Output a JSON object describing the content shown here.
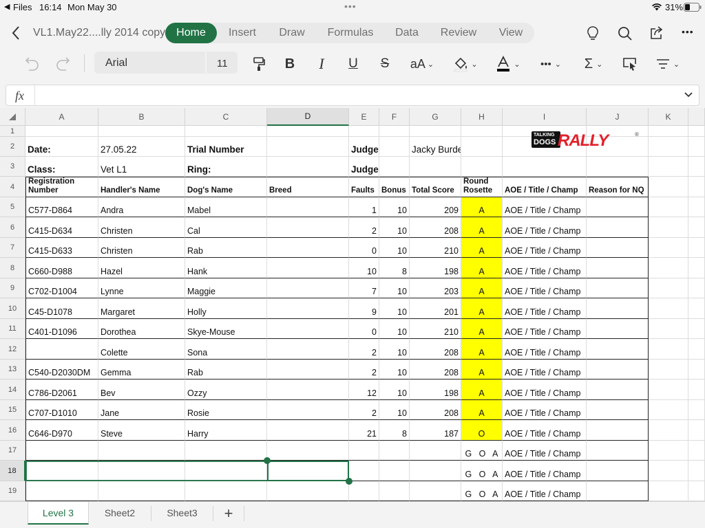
{
  "status": {
    "back_app": "Files",
    "time": "16:14",
    "date": "Mon May 30",
    "battery": "31%"
  },
  "nav": {
    "file_title": "VL1.May22....lly 2014 copy"
  },
  "ribbon_tabs": [
    {
      "label": "Home",
      "active": true
    },
    {
      "label": "Insert"
    },
    {
      "label": "Draw"
    },
    {
      "label": "Formulas"
    },
    {
      "label": "Data"
    },
    {
      "label": "Review"
    },
    {
      "label": "View"
    }
  ],
  "toolbar": {
    "font_name": "Arial",
    "font_size": "11",
    "text_color": "#000000"
  },
  "formula_bar": {
    "fx_label": "fx",
    "value": ""
  },
  "columns": [
    "A",
    "B",
    "C",
    "D",
    "E",
    "F",
    "G",
    "H",
    "I",
    "J",
    "K"
  ],
  "rows": [
    "1",
    "2",
    "3",
    "4",
    "5",
    "6",
    "7",
    "8",
    "9",
    "10",
    "11",
    "12",
    "13",
    "14",
    "15",
    "16",
    "17",
    "18",
    "19"
  ],
  "selected_cell": "D18",
  "logo": {
    "talking": "TALKING",
    "dogs": "DOGS",
    "rally": "RALLY",
    "reg": "®"
  },
  "sheet": {
    "r2": {
      "a": "Date:",
      "b": "27.05.22",
      "c": "Trial Number",
      "e": "Judge:",
      "g": "Jacky Burden"
    },
    "r3": {
      "a": "Class:",
      "b": "Vet L1",
      "c": "Ring:",
      "e": "Judge's Signature:"
    },
    "headers": {
      "reg": "Registration Number",
      "handler": "Handler's Name",
      "dog": "Dog's Name",
      "breed": "Breed",
      "faults": "Faults",
      "bonus": "Bonus",
      "total": "Total Score",
      "rosette": "Round Rosette",
      "aoe": "AOE / Title / Champ",
      "nq": "Reason for NQ"
    },
    "entries": [
      {
        "reg": "C577-D864",
        "handler": "Andra",
        "dog": "Mabel",
        "breed": "",
        "faults": "1",
        "bonus": "10",
        "total": "209",
        "rosette": "A",
        "aoe": "AOE / Title / Champ"
      },
      {
        "reg": "C415-D634",
        "handler": "Christen",
        "dog": "Cal",
        "breed": "",
        "faults": "2",
        "bonus": "10",
        "total": "208",
        "rosette": "A",
        "aoe": "AOE / Title / Champ"
      },
      {
        "reg": "C415-D633",
        "handler": "Christen",
        "dog": "Rab",
        "breed": "",
        "faults": "0",
        "bonus": "10",
        "total": "210",
        "rosette": "A",
        "aoe": "AOE / Title / Champ"
      },
      {
        "reg": "C660-D988",
        "handler": "Hazel",
        "dog": "Hank",
        "breed": "",
        "faults": "10",
        "bonus": "8",
        "total": "198",
        "rosette": "A",
        "aoe": "AOE / Title / Champ"
      },
      {
        "reg": "C702-D1004",
        "handler": "Lynne",
        "dog": "Maggie",
        "breed": "",
        "faults": "7",
        "bonus": "10",
        "total": "203",
        "rosette": "A",
        "aoe": "AOE / Title / Champ"
      },
      {
        "reg": "C45-D1078",
        "handler": "Margaret",
        "dog": "Holly",
        "breed": "",
        "faults": "9",
        "bonus": "10",
        "total": "201",
        "rosette": "A",
        "aoe": "AOE / Title / Champ"
      },
      {
        "reg": "C401-D1096",
        "handler": "Dorothea",
        "dog": "Skye-Mouse",
        "breed": "",
        "faults": "0",
        "bonus": "10",
        "total": "210",
        "rosette": "A",
        "aoe": "AOE / Title / Champ"
      },
      {
        "reg": "",
        "handler": "Colette",
        "dog": "Sona",
        "breed": "",
        "faults": "2",
        "bonus": "10",
        "total": "208",
        "rosette": "A",
        "aoe": "AOE / Title / Champ"
      },
      {
        "reg": "C540-D2030DM",
        "handler": "Gemma",
        "dog": "Rab",
        "breed": "",
        "faults": "2",
        "bonus": "10",
        "total": "208",
        "rosette": "A",
        "aoe": "AOE / Title / Champ"
      },
      {
        "reg": "C786-D2061",
        "handler": "Bev",
        "dog": "Ozzy",
        "breed": "",
        "faults": "12",
        "bonus": "10",
        "total": "198",
        "rosette": "A",
        "aoe": "AOE / Title / Champ"
      },
      {
        "reg": "C707-D1010",
        "handler": "Jane",
        "dog": "Rosie",
        "breed": "",
        "faults": "2",
        "bonus": "10",
        "total": "208",
        "rosette": "A",
        "aoe": "AOE / Title / Champ"
      },
      {
        "reg": "C646-D970",
        "handler": "Steve",
        "dog": "Harry",
        "breed": "",
        "faults": "21",
        "bonus": "8",
        "total": "187",
        "rosette": "O",
        "aoe": "AOE / Title / Champ"
      },
      {
        "reg": "",
        "handler": "",
        "dog": "",
        "breed": "",
        "faults": "",
        "bonus": "",
        "total": "",
        "rosette": "G   O   A",
        "aoe": "AOE / Title / Champ"
      },
      {
        "reg": "",
        "handler": "",
        "dog": "",
        "breed": "",
        "faults": "",
        "bonus": "",
        "total": "",
        "rosette": "G   O   A",
        "aoe": "AOE / Title / Champ"
      },
      {
        "reg": "",
        "handler": "",
        "dog": "",
        "breed": "",
        "faults": "",
        "bonus": "",
        "total": "",
        "rosette": "G   O   A",
        "aoe": "AOE / Title / Champ"
      }
    ]
  },
  "sheet_tabs": [
    {
      "label": "Level 3",
      "active": true
    },
    {
      "label": "Sheet2"
    },
    {
      "label": "Sheet3"
    }
  ],
  "colors": {
    "accent": "#217346",
    "highlight": "#ffff00"
  }
}
